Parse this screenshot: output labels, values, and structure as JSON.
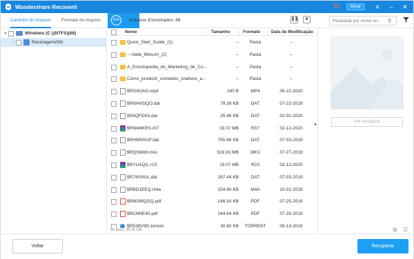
{
  "titlebar": {
    "app_title": "Wondershare Recoverit",
    "activate_label": "Ativar"
  },
  "tabs": {
    "path_tab": "Caminho do Arquivo",
    "format_tab": "Formato do Arquivo"
  },
  "scan": {
    "progress_text": "15%",
    "found_label": "Arquivos Encontrados: 68"
  },
  "search": {
    "placeholder": "Pesquisar por nome ou..."
  },
  "tree": {
    "drive_label": "Windows (C:)(NTFS)(68)",
    "recycle_label": "Reciclagem(68)"
  },
  "table": {
    "headers": {
      "name": "Nome",
      "size": "Tamanho",
      "format": "Formato",
      "date": "Data de Modificação"
    },
    "rows": [
      {
        "name": "Quick_Start_Guide_(1)",
        "size": "--",
        "type": "Pasta",
        "date": "--"
      },
      {
        "name": "---Vade_Mecum_(2)",
        "size": "--",
        "type": "Pasta",
        "date": "--"
      },
      {
        "name": "A_Enciclopedia_do_Marketing_de_Co...",
        "size": "--",
        "type": "Pasta",
        "date": "--"
      },
      {
        "name": "Como_produzir_contedos_criativos_a...",
        "size": "--",
        "type": "Pasta",
        "date": "--"
      },
      {
        "name": "$RGI9JAD.mp4",
        "size": "240 B",
        "type": "MP4",
        "date": "06-22-2020"
      },
      {
        "name": "$RWAVDQO.dat",
        "size": "78.39 KB",
        "type": "DAT",
        "date": "07-22-2019"
      },
      {
        "name": "$R4QFEK5.dat",
        "size": "25.46 KB",
        "type": "DAT",
        "date": "02-02-2020"
      },
      {
        "name": "$RW46KRS.r07",
        "size": "19.07 MB",
        "type": "R07",
        "date": "02-12-2020"
      },
      {
        "name": "$RHMNSUF.dat",
        "size": "755.86 KB",
        "type": "DAT",
        "date": "07-03-2019"
      },
      {
        "name": "$RQS66I9.mkv",
        "size": "519.83 MB",
        "type": "MKV",
        "date": "07-27-2019"
      },
      {
        "name": "$RYUAQIL.r23",
        "size": "19.07 MB",
        "type": "R23",
        "date": "02-12-2020"
      },
      {
        "name": "$R74XNUL.dat",
        "size": "287.44 KB",
        "type": "DAT",
        "date": "07-03-2019"
      },
      {
        "name": "$RBD1EEQ.m4a",
        "size": "154.80 KB",
        "type": "M4A",
        "date": "10-31-2019"
      },
      {
        "name": "$RM3WQGQ.pdf",
        "size": "146.93 KB",
        "type": "PDF",
        "date": "07-25-2019"
      },
      {
        "name": "$RCM0E45.pdf",
        "size": "244.64 KB",
        "type": "PDF",
        "date": "07-25-2019"
      },
      {
        "name": "$RS38V9D.torrent",
        "size": "30.60 KB",
        "type": "TORRENT",
        "date": "08-13-2019"
      }
    ],
    "status": "68 itens, 36.39 GB"
  },
  "preview": {
    "button_label": "Pré-visualizar"
  },
  "footer": {
    "back_label": "Voltar",
    "recover_label": "Recuperar"
  },
  "colors": {
    "accent": "#1787e0",
    "recover_button": "#1da0f2",
    "folder": "#f5c242"
  }
}
